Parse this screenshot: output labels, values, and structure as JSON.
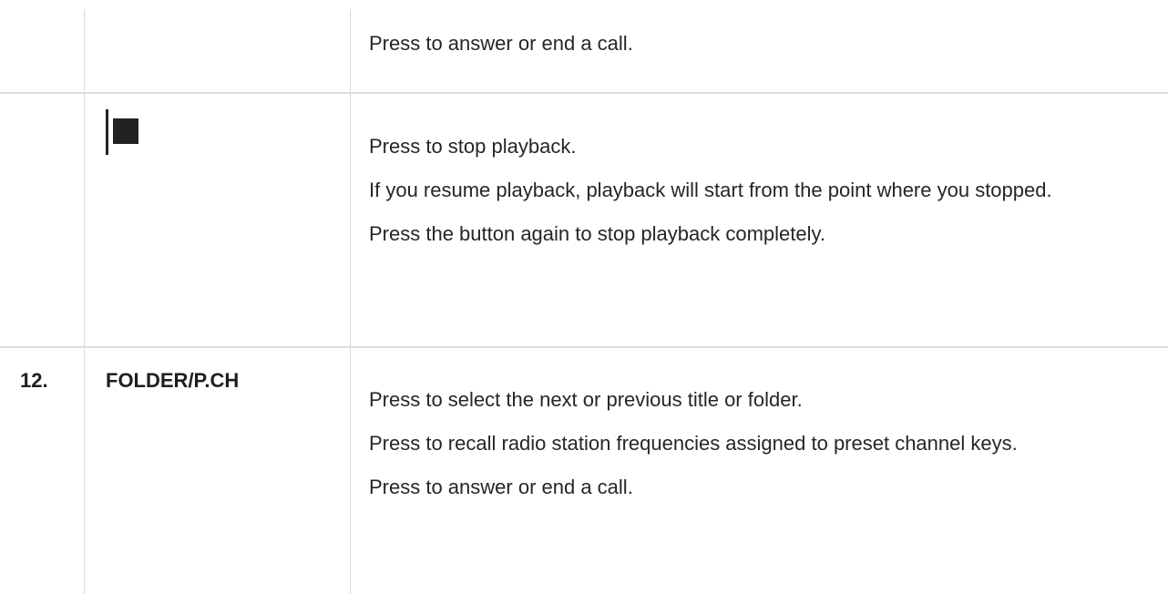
{
  "rows": [
    {
      "number": "",
      "button": "",
      "icon": "",
      "description": [
        "Press to answer or end a call."
      ]
    },
    {
      "number": "",
      "button": "",
      "icon": "stop-icon",
      "description": [
        "Press to stop playback.",
        "If you resume playback, playback will start from the point where you stopped.",
        "Press the button again to stop playback completely."
      ]
    },
    {
      "number": "12.",
      "button": "FOLDER/P.CH",
      "icon": "",
      "description": [
        "Press to select the next or previous title or folder.",
        "Press to recall radio station frequencies assigned to preset channel keys.",
        "Press to answer or end a call."
      ]
    }
  ]
}
